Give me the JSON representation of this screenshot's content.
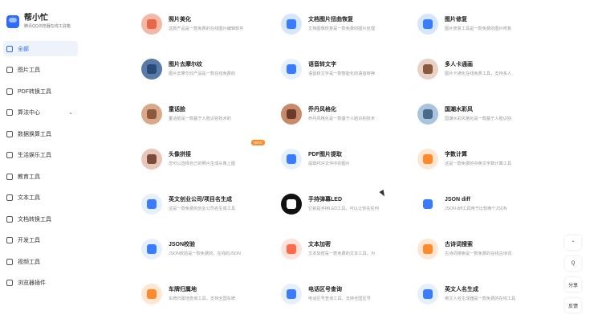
{
  "app": {
    "title": "帮小忙",
    "subtitle": "腾讯QQ浏览器在线工具箱"
  },
  "sidebar": {
    "items": [
      {
        "label": "全部",
        "active": true
      },
      {
        "label": "图片工具"
      },
      {
        "label": "PDF转换工具"
      },
      {
        "label": "算法中心",
        "chevron": "⌄"
      },
      {
        "label": "数据换算工具"
      },
      {
        "label": "生活娱乐工具"
      },
      {
        "label": "教育工具"
      },
      {
        "label": "文本工具"
      },
      {
        "label": "文档转换工具"
      },
      {
        "label": "开发工具"
      },
      {
        "label": "视频工具"
      },
      {
        "label": "浏览器插件"
      }
    ]
  },
  "tools": [
    {
      "title": "照片美化",
      "desc": "这款产品是一款免费的在线图片编辑软件",
      "color": "#f4b8a7",
      "glyph": "#e8664a"
    },
    {
      "title": "文档图片扭曲恢复",
      "desc": "文档图像恢复是一款免费的图片处理",
      "color": "#d7e6ff",
      "glyph": "#3a7cff"
    },
    {
      "title": "图片修复",
      "desc": "图片修复工具是一款免费的图片修复",
      "color": "#d7e6ff",
      "glyph": "#3a7cff"
    },
    {
      "title": "图片去摩尔纹",
      "desc": "图片去摩尔纹产品是一款在线免费的",
      "color": "#5a7ba8",
      "glyph": "#2a4a7a"
    },
    {
      "title": "语音转文字",
      "desc": "语音转文字是一款智能化的语音转换",
      "color": "#e6efff",
      "glyph": "#3a7cff"
    },
    {
      "title": "多人卡通画",
      "desc": "图片卡通化在线免费工具，支持多人",
      "color": "#e9d2c4",
      "glyph": "#8a5a40"
    },
    {
      "title": "童话脸",
      "desc": "童话脸是一款基于人脸识别技术的",
      "color": "#d9a98a",
      "glyph": "#8a5a40"
    },
    {
      "title": "乔丹风格化",
      "desc": "乔丹风格化是一款基于人脸识别技术",
      "color": "#c98a6a",
      "glyph": "#6a3a2a"
    },
    {
      "title": "国潮水彩风",
      "desc": "国潮水彩风格化是一款基于人脸识别",
      "color": "#a9c4dc",
      "glyph": "#4a6a8a"
    },
    {
      "title": "头像拼接",
      "desc": "您可以选择自己的照片生成头像上图",
      "color": "#e8c6b8",
      "glyph": "#7a4a3a",
      "badge": "NEW"
    },
    {
      "title": "PDF图片提取",
      "desc": "提取PDF文件中的图片",
      "color": "#e6efff",
      "glyph": "#3a7cff"
    },
    {
      "title": "字数计算",
      "desc": "这是一款免费的中英文字数计算工具",
      "color": "#ffe6d2",
      "glyph": "#ff8a2b"
    },
    {
      "title": "英文创业公司/项目名生成",
      "desc": "这是一款免费的创业公司名生成工具",
      "color": "#e6efff",
      "glyph": "#3a7cff"
    },
    {
      "title": "手持弹幕LED",
      "desc": "它就是手持LED工具，可以让你在任何",
      "color": "#111111",
      "glyph": "#ffffff"
    },
    {
      "title": "JSON diff",
      "desc": "JSON diff工具用于比较两个JSON",
      "color": "#ffffff",
      "glyph": "#3a7cff"
    },
    {
      "title": "JSON校验",
      "desc": "JSON校验是一款免费的、在线的JSON",
      "color": "#e6efff",
      "glyph": "#3a7cff"
    },
    {
      "title": "文本加密",
      "desc": "文本加密是一款免费的文本工具，为",
      "color": "#ffe2dc",
      "glyph": "#ff6a4a"
    },
    {
      "title": "古诗词搜索",
      "desc": "古诗词搜索是一款免费的在线古诗词",
      "color": "#ffe6d2",
      "glyph": "#ff8a2b"
    },
    {
      "title": "车牌归属地",
      "desc": "车牌归属地查询工具，支持全国车牌",
      "color": "#ffe6d2",
      "glyph": "#ff8a2b"
    },
    {
      "title": "电话区号查询",
      "desc": "电话区号查询工具，支持全国区号",
      "color": "#e6efff",
      "glyph": "#3a7cff"
    },
    {
      "title": "英文人名生成",
      "desc": "英文人名生成器是一款免费的在线工具",
      "color": "#e6efff",
      "glyph": "#3a7cff"
    }
  ],
  "float_tools": {
    "top_label": "⌃",
    "qq_label": "Q",
    "share_label": "分享",
    "feedback_label": "反馈"
  }
}
